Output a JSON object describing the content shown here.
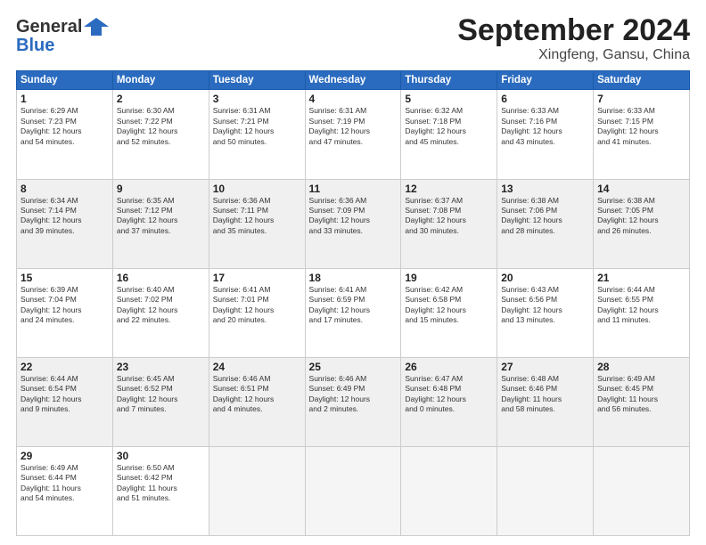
{
  "header": {
    "logo_line1": "General",
    "logo_line2": "Blue",
    "month": "September 2024",
    "location": "Xingfeng, Gansu, China"
  },
  "weekdays": [
    "Sunday",
    "Monday",
    "Tuesday",
    "Wednesday",
    "Thursday",
    "Friday",
    "Saturday"
  ],
  "weeks": [
    [
      {
        "day": "1",
        "rise": "6:29 AM",
        "set": "7:23 PM",
        "hours": "12 hours",
        "min": "54 minutes."
      },
      {
        "day": "2",
        "rise": "6:30 AM",
        "set": "7:22 PM",
        "hours": "12 hours",
        "min": "52 minutes."
      },
      {
        "day": "3",
        "rise": "6:31 AM",
        "set": "7:21 PM",
        "hours": "12 hours",
        "min": "50 minutes."
      },
      {
        "day": "4",
        "rise": "6:31 AM",
        "set": "7:19 PM",
        "hours": "12 hours",
        "min": "47 minutes."
      },
      {
        "day": "5",
        "rise": "6:32 AM",
        "set": "7:18 PM",
        "hours": "12 hours",
        "min": "45 minutes."
      },
      {
        "day": "6",
        "rise": "6:33 AM",
        "set": "7:16 PM",
        "hours": "12 hours",
        "min": "43 minutes."
      },
      {
        "day": "7",
        "rise": "6:33 AM",
        "set": "7:15 PM",
        "hours": "12 hours",
        "min": "41 minutes."
      }
    ],
    [
      {
        "day": "8",
        "rise": "6:34 AM",
        "set": "7:14 PM",
        "hours": "12 hours",
        "min": "39 minutes."
      },
      {
        "day": "9",
        "rise": "6:35 AM",
        "set": "7:12 PM",
        "hours": "12 hours",
        "min": "37 minutes."
      },
      {
        "day": "10",
        "rise": "6:36 AM",
        "set": "7:11 PM",
        "hours": "12 hours",
        "min": "35 minutes."
      },
      {
        "day": "11",
        "rise": "6:36 AM",
        "set": "7:09 PM",
        "hours": "12 hours",
        "min": "33 minutes."
      },
      {
        "day": "12",
        "rise": "6:37 AM",
        "set": "7:08 PM",
        "hours": "12 hours",
        "min": "30 minutes."
      },
      {
        "day": "13",
        "rise": "6:38 AM",
        "set": "7:06 PM",
        "hours": "12 hours",
        "min": "28 minutes."
      },
      {
        "day": "14",
        "rise": "6:38 AM",
        "set": "7:05 PM",
        "hours": "12 hours",
        "min": "26 minutes."
      }
    ],
    [
      {
        "day": "15",
        "rise": "6:39 AM",
        "set": "7:04 PM",
        "hours": "12 hours",
        "min": "24 minutes."
      },
      {
        "day": "16",
        "rise": "6:40 AM",
        "set": "7:02 PM",
        "hours": "12 hours",
        "min": "22 minutes."
      },
      {
        "day": "17",
        "rise": "6:41 AM",
        "set": "7:01 PM",
        "hours": "12 hours",
        "min": "20 minutes."
      },
      {
        "day": "18",
        "rise": "6:41 AM",
        "set": "6:59 PM",
        "hours": "12 hours",
        "min": "17 minutes."
      },
      {
        "day": "19",
        "rise": "6:42 AM",
        "set": "6:58 PM",
        "hours": "12 hours",
        "min": "15 minutes."
      },
      {
        "day": "20",
        "rise": "6:43 AM",
        "set": "6:56 PM",
        "hours": "12 hours",
        "min": "13 minutes."
      },
      {
        "day": "21",
        "rise": "6:44 AM",
        "set": "6:55 PM",
        "hours": "12 hours",
        "min": "11 minutes."
      }
    ],
    [
      {
        "day": "22",
        "rise": "6:44 AM",
        "set": "6:54 PM",
        "hours": "12 hours",
        "min": "9 minutes."
      },
      {
        "day": "23",
        "rise": "6:45 AM",
        "set": "6:52 PM",
        "hours": "12 hours",
        "min": "7 minutes."
      },
      {
        "day": "24",
        "rise": "6:46 AM",
        "set": "6:51 PM",
        "hours": "12 hours",
        "min": "4 minutes."
      },
      {
        "day": "25",
        "rise": "6:46 AM",
        "set": "6:49 PM",
        "hours": "12 hours",
        "min": "2 minutes."
      },
      {
        "day": "26",
        "rise": "6:47 AM",
        "set": "6:48 PM",
        "hours": "12 hours",
        "min": "0 minutes."
      },
      {
        "day": "27",
        "rise": "6:48 AM",
        "set": "6:46 PM",
        "hours": "11 hours",
        "min": "58 minutes."
      },
      {
        "day": "28",
        "rise": "6:49 AM",
        "set": "6:45 PM",
        "hours": "11 hours",
        "min": "56 minutes."
      }
    ],
    [
      {
        "day": "29",
        "rise": "6:49 AM",
        "set": "6:44 PM",
        "hours": "11 hours",
        "min": "54 minutes."
      },
      {
        "day": "30",
        "rise": "6:50 AM",
        "set": "6:42 PM",
        "hours": "11 hours",
        "min": "51 minutes."
      },
      null,
      null,
      null,
      null,
      null
    ]
  ]
}
